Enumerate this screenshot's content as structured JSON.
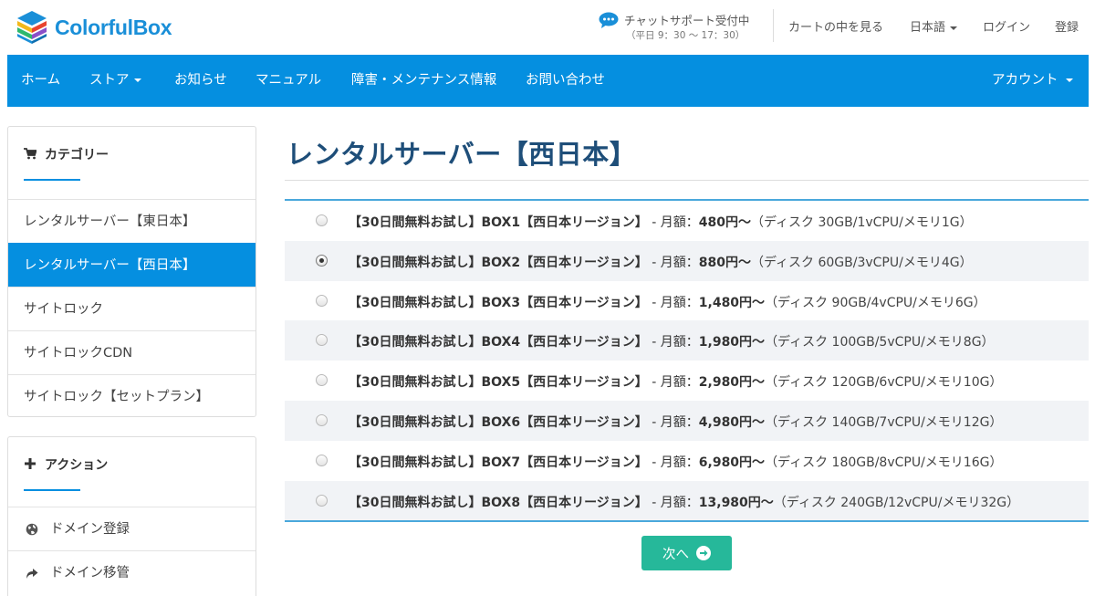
{
  "brand": {
    "name": "ColorfulBox"
  },
  "chat": {
    "title": "チャットサポート受付中",
    "hours": "（平日 9：30 〜 17：30）"
  },
  "top_links": {
    "cart": "カートの中を見る",
    "language": "日本語",
    "login": "ログイン",
    "register": "登録"
  },
  "nav": {
    "items": [
      "ホーム",
      "ストア",
      "お知らせ",
      "マニュアル",
      "障害・メンテナンス情報",
      "お問い合わせ"
    ],
    "account": "アカウント"
  },
  "sidebar": {
    "categories": {
      "title": "カテゴリー",
      "icon": "cart-icon",
      "items": [
        "レンタルサーバー【東日本】",
        "レンタルサーバー【西日本】",
        "サイトロック",
        "サイトロックCDN",
        "サイトロック【セットプラン】"
      ],
      "active_index": 1
    },
    "actions": {
      "title": "アクション",
      "icon": "plus-icon",
      "items": [
        {
          "label": "ドメイン登録",
          "icon": "globe-icon"
        },
        {
          "label": "ドメイン移管",
          "icon": "share-arrow-icon"
        }
      ]
    }
  },
  "main": {
    "title": "レンタルサーバー【西日本】",
    "products": [
      {
        "name": "【30日間無料お試し】BOX1【西日本リージョン】",
        "sep": " - 月額：",
        "price": "480円〜",
        "desc": "（ディスク 30GB/1vCPU/メモリ1G）",
        "selected": false
      },
      {
        "name": "【30日間無料お試し】BOX2【西日本リージョン】",
        "sep": " - 月額：",
        "price": "880円〜",
        "desc": "（ディスク 60GB/3vCPU/メモリ4G）",
        "selected": true
      },
      {
        "name": "【30日間無料お試し】BOX3【西日本リージョン】",
        "sep": " - 月額：",
        "price": "1,480円〜",
        "desc": "（ディスク 90GB/4vCPU/メモリ6G）",
        "selected": false
      },
      {
        "name": "【30日間無料お試し】BOX4【西日本リージョン】",
        "sep": " - 月額：",
        "price": "1,980円〜",
        "desc": "（ディスク 100GB/5vCPU/メモリ8G）",
        "selected": false
      },
      {
        "name": "【30日間無料お試し】BOX5【西日本リージョン】",
        "sep": " - 月額：",
        "price": "2,980円〜",
        "desc": "（ディスク 120GB/6vCPU/メモリ10G）",
        "selected": false
      },
      {
        "name": "【30日間無料お試し】BOX6【西日本リージョン】",
        "sep": " - 月額：",
        "price": "4,980円〜",
        "desc": "（ディスク 140GB/7vCPU/メモリ12G）",
        "selected": false
      },
      {
        "name": "【30日間無料お試し】BOX7【西日本リージョン】",
        "sep": " - 月額：",
        "price": "6,980円〜",
        "desc": "（ディスク 180GB/8vCPU/メモリ16G）",
        "selected": false
      },
      {
        "name": "【30日間無料お試し】BOX8【西日本リージョン】",
        "sep": " - 月額：",
        "price": "13,980円〜",
        "desc": "（ディスク 240GB/12vCPU/メモリ32G）",
        "selected": false
      }
    ],
    "next_label": "次へ"
  },
  "colors": {
    "primary": "#058fe0",
    "title": "#1e4e79",
    "button": "#26b89a",
    "logo": "#1a8fd8"
  }
}
